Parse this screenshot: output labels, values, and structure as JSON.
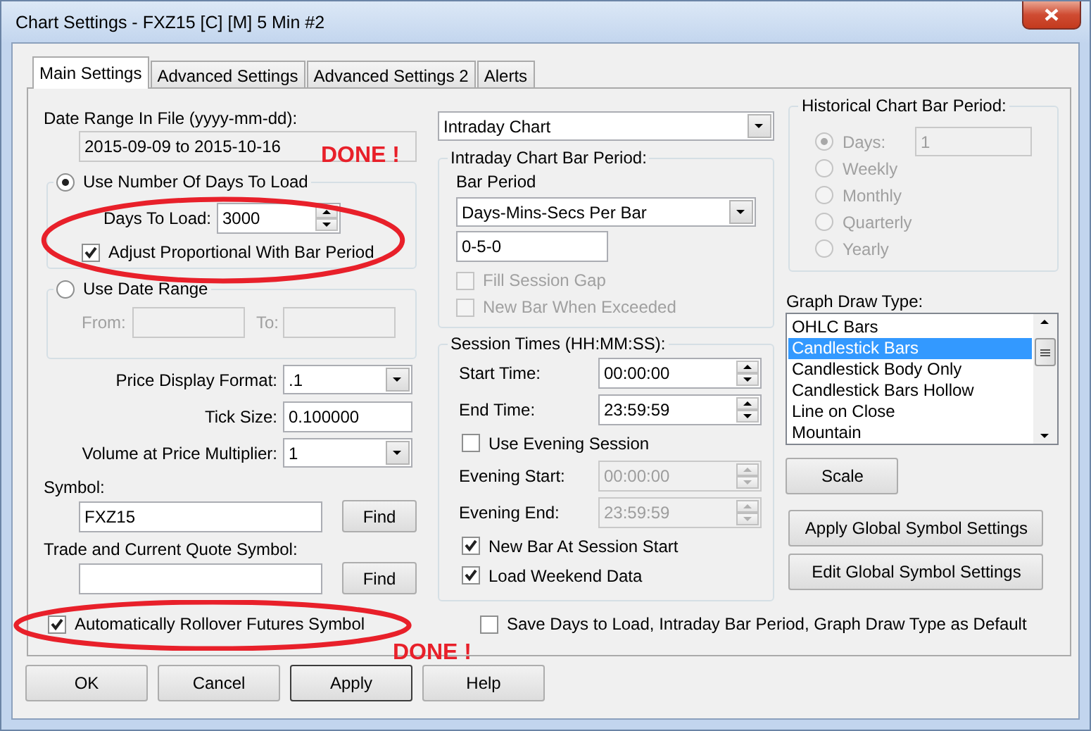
{
  "window": {
    "title": "Chart Settings - FXZ15 [C] [M]  5 Min   #2"
  },
  "tabs": [
    {
      "label": "Main Settings",
      "selected": true
    },
    {
      "label": "Advanced Settings",
      "selected": false
    },
    {
      "label": "Advanced Settings 2",
      "selected": false
    },
    {
      "label": "Alerts",
      "selected": false
    }
  ],
  "date_range_in_file": {
    "label": "Date Range In File (yyyy-mm-dd):",
    "value": "2015-09-09 to 2015-10-16"
  },
  "load_mode": [
    {
      "label": "Use Number Of Days To Load",
      "selected": true
    },
    {
      "label": "Use Date Range",
      "selected": false
    }
  ],
  "days_to_load": {
    "label": "Days To Load:",
    "value": "3000"
  },
  "adjust_proportional": {
    "label": "Adjust Proportional With Bar Period",
    "checked": true
  },
  "date_range": {
    "from_label": "From:",
    "to_label": "To:",
    "disabled": true
  },
  "format_fields": [
    {
      "kind": "combo",
      "label": "Price Display Format:",
      "value": ".1"
    },
    {
      "kind": "text",
      "label": "Tick Size:",
      "value": "0.100000"
    },
    {
      "kind": "combo",
      "label": "Volume at Price Multiplier:",
      "value": "1"
    }
  ],
  "symbols": [
    {
      "label": "Symbol:",
      "value": "FXZ15",
      "button": "Find"
    },
    {
      "label": "Trade and Current Quote Symbol:",
      "button": "Find"
    }
  ],
  "rollover": {
    "label": "Automatically Rollover Futures Symbol",
    "checked": true
  },
  "chart_type": {
    "value": "Intraday Chart"
  },
  "intraday_bar_period": {
    "title": "Intraday Chart Bar Period:",
    "bar_period_label": "Bar Period",
    "bar_period_value": "Days-Mins-Secs Per Bar",
    "period_value": "0-5-0",
    "options": [
      {
        "label": "Fill Session Gap",
        "checked": false,
        "disabled": true
      },
      {
        "label": "New Bar When Exceeded",
        "checked": false,
        "disabled": true
      }
    ]
  },
  "session_times": {
    "title": "Session Times (HH:MM:SS):",
    "rows": [
      {
        "kind": "time",
        "label": "Start Time:",
        "value": "00:00:00",
        "disabled": false
      },
      {
        "kind": "time",
        "label": "End Time:",
        "value": "23:59:59",
        "disabled": false
      },
      {
        "kind": "check",
        "label": "Use Evening Session",
        "checked": false
      },
      {
        "kind": "time",
        "label": "Evening Start:",
        "value": "00:00:00",
        "disabled": true
      },
      {
        "kind": "time",
        "label": "Evening End:",
        "value": "23:59:59",
        "disabled": true
      },
      {
        "kind": "check",
        "label": "New Bar At Session Start",
        "checked": true
      },
      {
        "kind": "check",
        "label": "Load Weekend Data",
        "checked": true
      }
    ]
  },
  "historical": {
    "title": "Historical Chart Bar Period:",
    "disabled": true,
    "days_value": "1",
    "options": [
      {
        "label": "Days:",
        "selected": true
      },
      {
        "label": "Weekly",
        "selected": false
      },
      {
        "label": "Monthly",
        "selected": false
      },
      {
        "label": "Quarterly",
        "selected": false
      },
      {
        "label": "Yearly",
        "selected": false
      }
    ]
  },
  "graph_draw_type": {
    "label": "Graph Draw Type:",
    "items": [
      {
        "label": "OHLC Bars",
        "selected": false
      },
      {
        "label": "Candlestick Bars",
        "selected": true
      },
      {
        "label": "Candlestick Body Only",
        "selected": false
      },
      {
        "label": "Candlestick Bars Hollow",
        "selected": false
      },
      {
        "label": "Line on Close",
        "selected": false
      },
      {
        "label": "Mountain",
        "selected": false
      }
    ]
  },
  "side_buttons": [
    "Scale",
    "Apply Global Symbol Settings",
    "Edit Global Symbol Settings"
  ],
  "save_default": {
    "label": "Save Days to Load, Intraday Bar Period, Graph Draw Type as Default",
    "checked": false
  },
  "dialog_buttons": [
    {
      "label": "OK",
      "focused": false
    },
    {
      "label": "Cancel",
      "focused": false
    },
    {
      "label": "Apply",
      "focused": true
    },
    {
      "label": "Help",
      "focused": false
    }
  ],
  "annotations": [
    {
      "kind": "ellipse"
    },
    {
      "kind": "text",
      "text": "DONE !"
    },
    {
      "kind": "ellipse"
    },
    {
      "kind": "text",
      "text": "DONE !"
    }
  ]
}
